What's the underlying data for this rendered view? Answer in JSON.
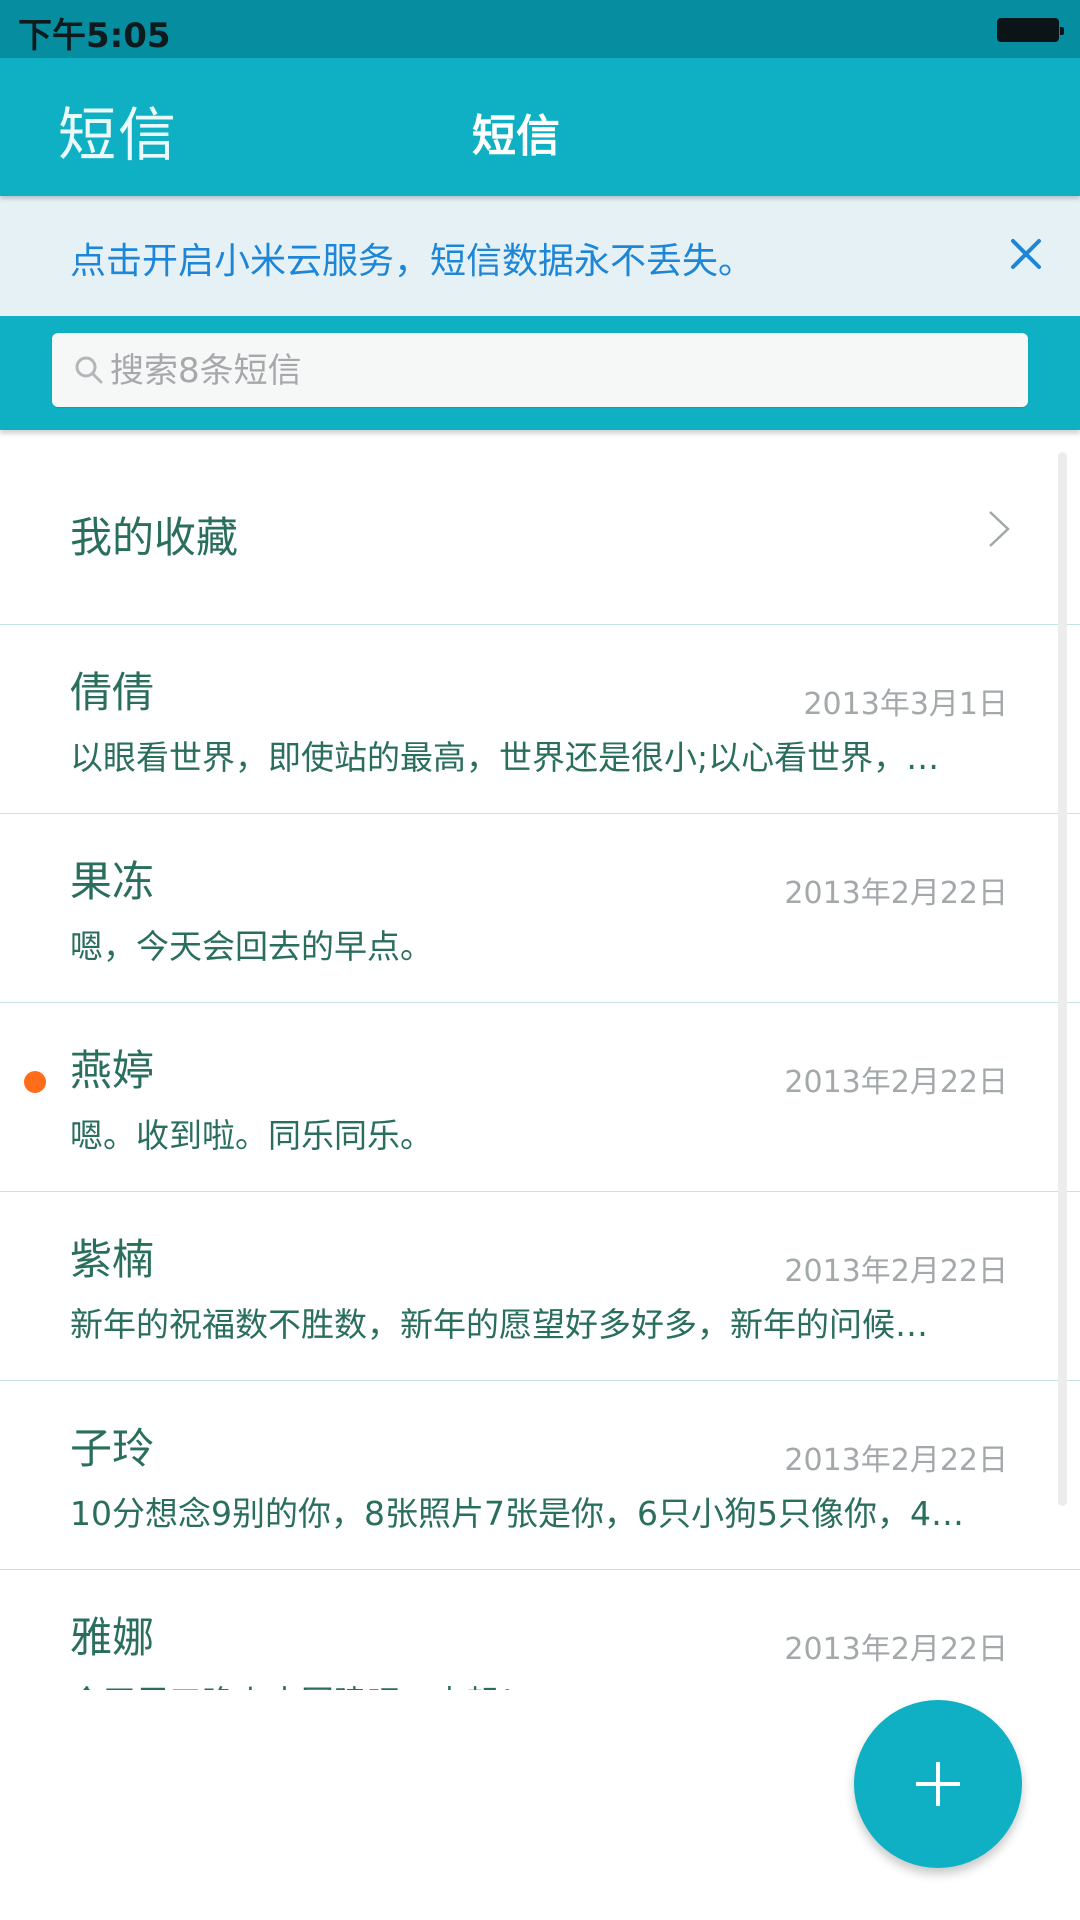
{
  "status_bar": {
    "time": "下午5:05"
  },
  "header": {
    "left_title": "短信",
    "center_title": "短信"
  },
  "banner": {
    "text": "点击开启小米云服务，短信数据永不丢失。"
  },
  "search": {
    "placeholder": "搜索8条短信",
    "value": ""
  },
  "favorites": {
    "label": "我的收藏"
  },
  "conversations": [
    {
      "name": "倩倩",
      "date": "2013年3月1日",
      "preview": "以眼看世界，即使站的最高，世界还是很小;以心看世界，…",
      "unread": false
    },
    {
      "name": "果冻",
      "date": "2013年2月22日",
      "preview": "嗯，今天会回去的早点。",
      "unread": false
    },
    {
      "name": "燕婷",
      "date": "2013年2月22日",
      "preview": "嗯。收到啦。同乐同乐。",
      "unread": true
    },
    {
      "name": "紫楠",
      "date": "2013年2月22日",
      "preview": "新年的祝福数不胜数，新年的愿望好多好多，新年的问候…",
      "unread": false
    },
    {
      "name": "子玲",
      "date": "2013年2月22日",
      "preview": "10分想念9别的你，8张照片7张是你，6只小狗5只像你，4…",
      "unread": false
    },
    {
      "name": "雅娜",
      "date": "2013年2月22日",
      "preview": "今天周五晚上去团建吧，走起！",
      "unread": false
    }
  ],
  "colors": {
    "accent": "#0fb0c3",
    "status_bar": "#078da0",
    "banner_bg": "#e6f1f6",
    "banner_text": "#1e86d6",
    "unread": "#ff6d1a",
    "text_primary": "#2a6e5c",
    "text_secondary": "#a3a9ab"
  },
  "icons": {
    "banner_close": "close-icon",
    "search": "search-icon",
    "favorites": "chevron-right-icon",
    "fab": "plus-icon"
  }
}
